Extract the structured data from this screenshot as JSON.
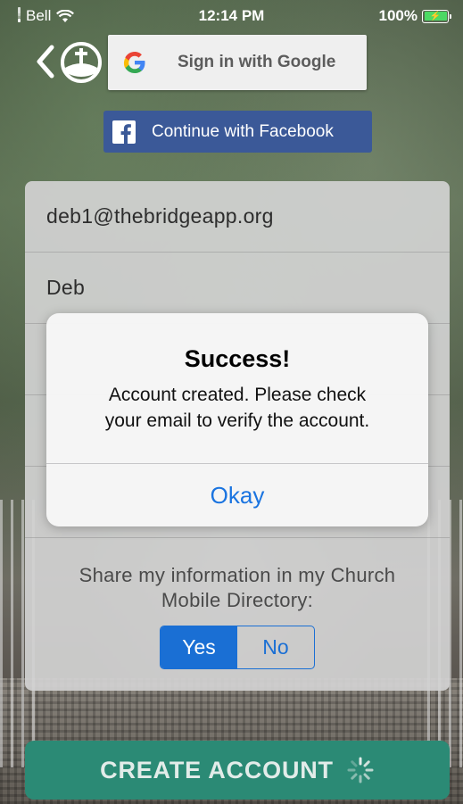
{
  "status_bar": {
    "carrier": "Bell",
    "time": "12:14 PM",
    "battery": "100%"
  },
  "social": {
    "google_label": "Sign in with Google",
    "facebook_label": "Continue with Facebook"
  },
  "form": {
    "email_value": "deb1@thebridgeapp.org",
    "name_value": "Deb",
    "share_prompt_line1": "Share my information in my Church",
    "share_prompt_line2": "Mobile Directory:",
    "share_options": [
      "Yes",
      "No"
    ],
    "share_selected": "Yes"
  },
  "alert": {
    "title": "Success!",
    "message_line1": "Account created. Please check",
    "message_line2": "your email to verify the account.",
    "button_label": "Okay"
  },
  "footer": {
    "create_label": "CREATE ACCOUNT"
  },
  "colors": {
    "facebook_blue": "#3b5998",
    "segment_blue": "#1a6fd4",
    "create_button": "#2b8a75",
    "alert_button": "#1a74e0"
  },
  "icons": [
    "wifi-icon",
    "battery-icon",
    "back-chevron-icon",
    "church-logo-icon",
    "google-logo-icon",
    "facebook-logo-icon",
    "loading-spinner-icon"
  ]
}
